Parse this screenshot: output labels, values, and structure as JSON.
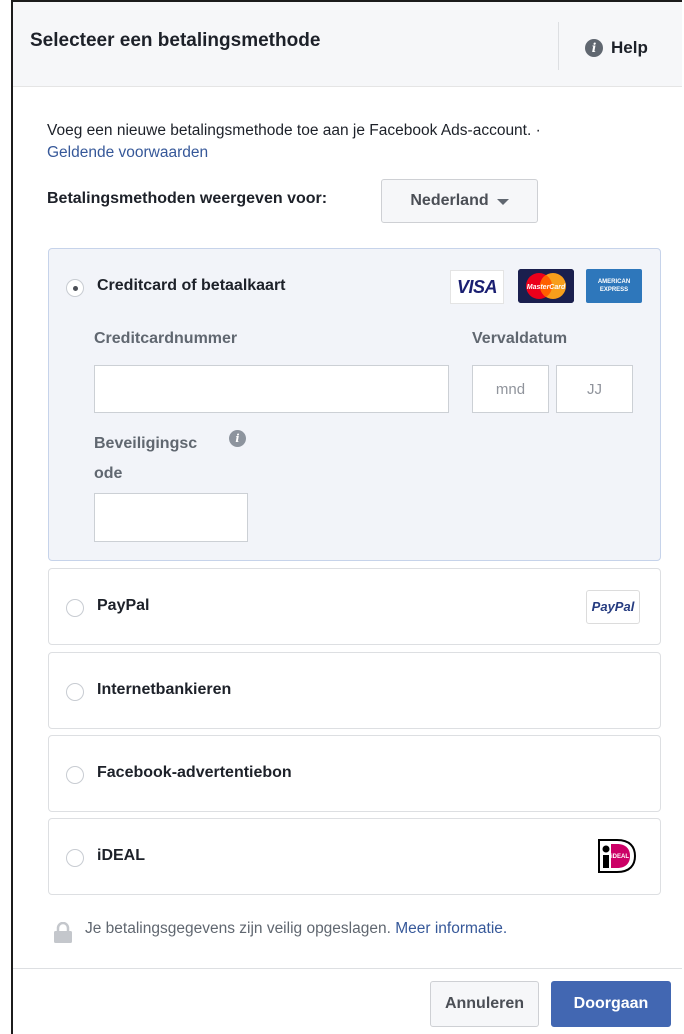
{
  "dialog": {
    "title": "Selecteer een betalingsmethode",
    "help_label": "Help",
    "intro_text": "Voeg een nieuwe betalingsmethode toe aan je Facebook Ads-account. ·",
    "terms_link": "Geldende voorwaarden",
    "show_for_label": "Betalingsmethoden weergeven voor:",
    "country_selected": "Nederland"
  },
  "payment_options": {
    "card": {
      "label": "Creditcard of betaalkaart",
      "selected": true,
      "card_number_label": "Creditcardnummer",
      "card_number_value": "",
      "expiry_label": "Vervaldatum",
      "month_placeholder": "mnd",
      "year_placeholder": "JJ",
      "security_label_line1": "Beveiligingsc",
      "security_label_line2": "ode",
      "security_value": "",
      "logos": {
        "visa": "VISA",
        "mastercard": "MasterCard",
        "amex_line1": "AMERICAN",
        "amex_line2": "EXPRESS"
      }
    },
    "paypal": {
      "label": "PayPal",
      "logo_text": "PayPal",
      "selected": false
    },
    "internet_banking": {
      "label": "Internetbankieren",
      "selected": false
    },
    "fb_coupon": {
      "label": "Facebook-advertentiebon",
      "selected": false
    },
    "ideal": {
      "label": "iDEAL",
      "logo_text": "iDEAL",
      "selected": false
    }
  },
  "footer": {
    "security_note": "Je betalingsgegevens zijn veilig opgeslagen.",
    "more_info_link": "Meer informatie.",
    "cancel_label": "Annuleren",
    "continue_label": "Doorgaan"
  },
  "colors": {
    "primary_button": "#4267b2",
    "link": "#365899",
    "selected_panel_bg": "#f2f4f9",
    "header_bg": "#f6f7f9"
  },
  "icons": [
    "info-icon",
    "chevron-down-icon",
    "lock-icon",
    "visa-logo",
    "mastercard-logo",
    "amex-logo",
    "paypal-logo",
    "ideal-logo"
  ]
}
